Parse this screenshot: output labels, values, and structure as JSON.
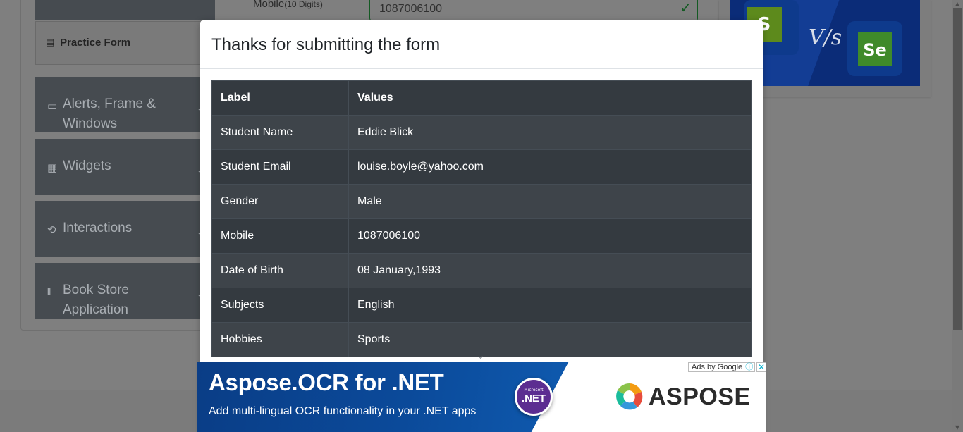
{
  "sidebar": {
    "practice_form_label": "Practice Form",
    "groups": [
      {
        "label_line1": "Alerts, Frame &",
        "label_line2": "Windows",
        "icon": "window-icon"
      },
      {
        "label_line1": "Widgets",
        "label_line2": "",
        "icon": "widgets-icon"
      },
      {
        "label_line1": "Interactions",
        "label_line2": "",
        "icon": "interactions-icon"
      },
      {
        "label_line1": "Book Store",
        "label_line2": "Application",
        "icon": "book-icon"
      }
    ]
  },
  "form": {
    "mobile_label": "Mobile",
    "mobile_hint": "(10 Digits)",
    "mobile_value": "1087006100"
  },
  "promo": {
    "s_label": "S",
    "vs_label": "V/s",
    "se_label": "Se"
  },
  "modal": {
    "title": "Thanks for submitting the form",
    "table": {
      "headers": [
        "Label",
        "Values"
      ],
      "rows": [
        [
          "Student Name",
          "Eddie Blick"
        ],
        [
          "Student Email",
          "louise.boyle@yahoo.com"
        ],
        [
          "Gender",
          "Male"
        ],
        [
          "Mobile",
          "1087006100"
        ],
        [
          "Date of Birth",
          "08 January,1993"
        ],
        [
          "Subjects",
          "English"
        ],
        [
          "Hobbies",
          "Sports"
        ]
      ]
    }
  },
  "ad": {
    "headline": "Aspose.OCR for .NET",
    "subline": "Add multi-lingual OCR functionality in your .NET apps",
    "badge_small": "Microsoft",
    "badge_big": ".NET",
    "brand": "ASPOSE",
    "choices_label": "Ads by Google",
    "info_glyph": "ⓘ",
    "close_glyph": "✕"
  },
  "colors": {
    "table_dark": "#343a40",
    "table_alt": "#3e444a",
    "ad_blue": "#0a3d86",
    "sidebar_group": "#464b50"
  }
}
